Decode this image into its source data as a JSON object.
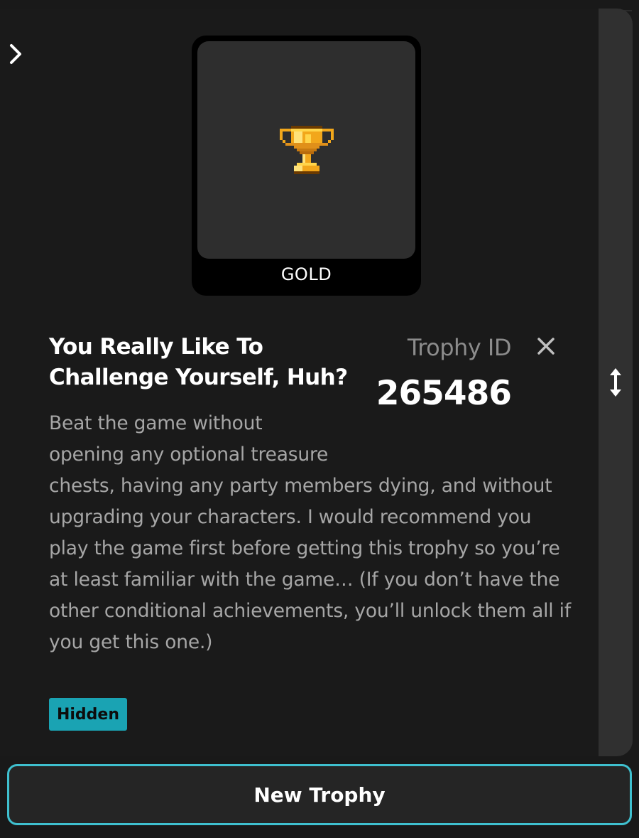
{
  "trophy": {
    "tier": "GOLD",
    "title": "You Really Like To Challenge Yourself, Huh?",
    "id_label": "Trophy ID",
    "id_value": "265486",
    "description_lines_top": [
      "Beat the game without",
      "opening any optional treasure"
    ],
    "description_rest": "chests, having any party members dying, and without upgrading your characters. I would recommend you play the game first before getting this trophy so you’re at least familiar with the game… (If you don’t have the other conditional achievements, you’ll unlock them all if you get this one.)",
    "badge": "Hidden"
  },
  "actions": {
    "new_trophy_label": "New Trophy"
  },
  "icons": {
    "expand": "chevron-right-icon",
    "close": "close-icon",
    "resize": "vertical-resize-icon",
    "trophy": "gold-trophy-icon"
  },
  "colors": {
    "background": "#1a1a1a",
    "accent": "#3fc0cf",
    "badge": "#1aa3b3",
    "muted_text": "#a6a6a6"
  }
}
